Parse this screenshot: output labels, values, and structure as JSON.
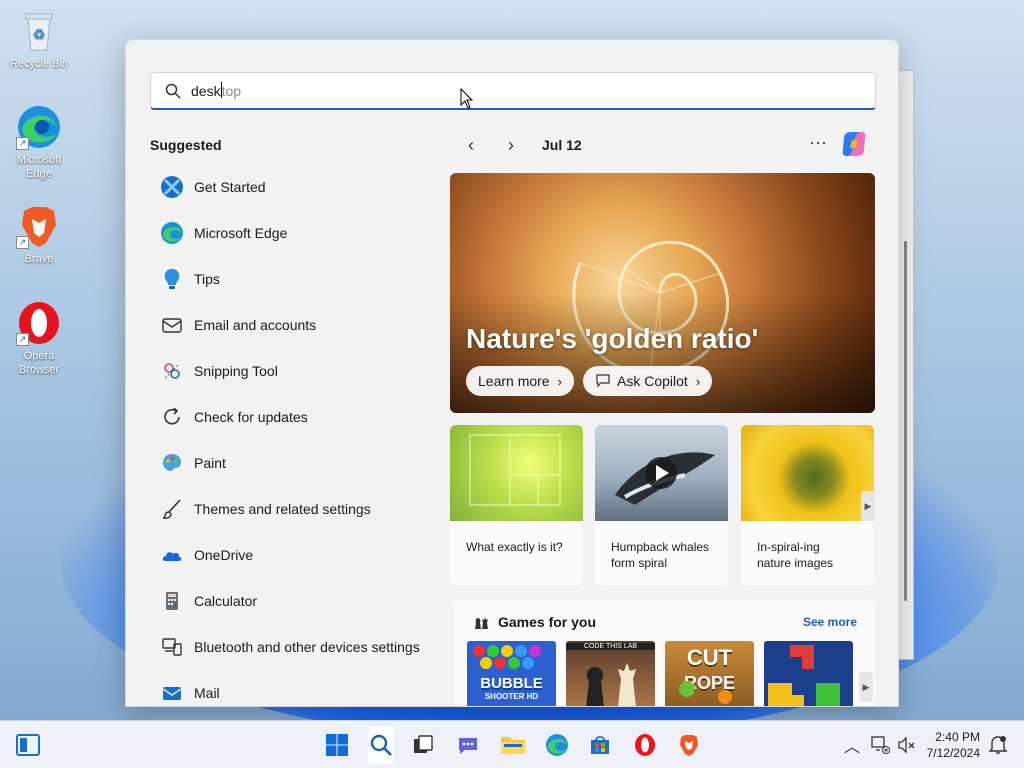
{
  "desktop": {
    "icons": [
      {
        "label_line1": "Recycle Bin",
        "label_line2": ""
      },
      {
        "label_line1": "Microsoft",
        "label_line2": "Edge"
      },
      {
        "label_line1": "Brave",
        "label_line2": ""
      },
      {
        "label_line1": "Opera",
        "label_line2": "Browser"
      }
    ]
  },
  "search": {
    "typed": "desk",
    "suggestion_tail": "top"
  },
  "suggested": {
    "title": "Suggested",
    "items": [
      {
        "label": "Get Started",
        "icon": "get-started-icon"
      },
      {
        "label": "Microsoft Edge",
        "icon": "edge-icon"
      },
      {
        "label": "Tips",
        "icon": "tips-icon"
      },
      {
        "label": "Email and accounts",
        "icon": "mail-outline-icon"
      },
      {
        "label": "Snipping Tool",
        "icon": "snipping-tool-icon"
      },
      {
        "label": "Check for updates",
        "icon": "refresh-icon"
      },
      {
        "label": "Paint",
        "icon": "paint-icon"
      },
      {
        "label": "Themes and related settings",
        "icon": "brush-icon"
      },
      {
        "label": "OneDrive",
        "icon": "onedrive-icon"
      },
      {
        "label": "Calculator",
        "icon": "calculator-icon"
      },
      {
        "label": "Bluetooth and other devices settings",
        "icon": "devices-icon"
      },
      {
        "label": "Mail",
        "icon": "mail-icon"
      }
    ]
  },
  "highlights": {
    "date": "Jul 12",
    "more": "···",
    "hero_title": "Nature's 'golden ratio'",
    "learn_more": "Learn more",
    "ask_copilot": "Ask Copilot",
    "cards": [
      {
        "line1": "What exactly is it?",
        "line2": ""
      },
      {
        "line1": "Humpback whales",
        "line2": "form spiral"
      },
      {
        "line1": "In-spiral-ing",
        "line2": "nature images"
      }
    ]
  },
  "games": {
    "title": "Games for you",
    "see_more": "See more",
    "tiles": [
      {
        "line1": "BUBBLE",
        "line2": "SHOOTER HD"
      },
      {
        "line1": "CODE THIS LAB",
        "line2": ""
      },
      {
        "line1": "CUT",
        "line2": "ROPE"
      },
      {
        "line1": "",
        "line2": ""
      }
    ]
  },
  "taskbar": {
    "time": "2:40 PM",
    "date": "7/12/2024"
  }
}
